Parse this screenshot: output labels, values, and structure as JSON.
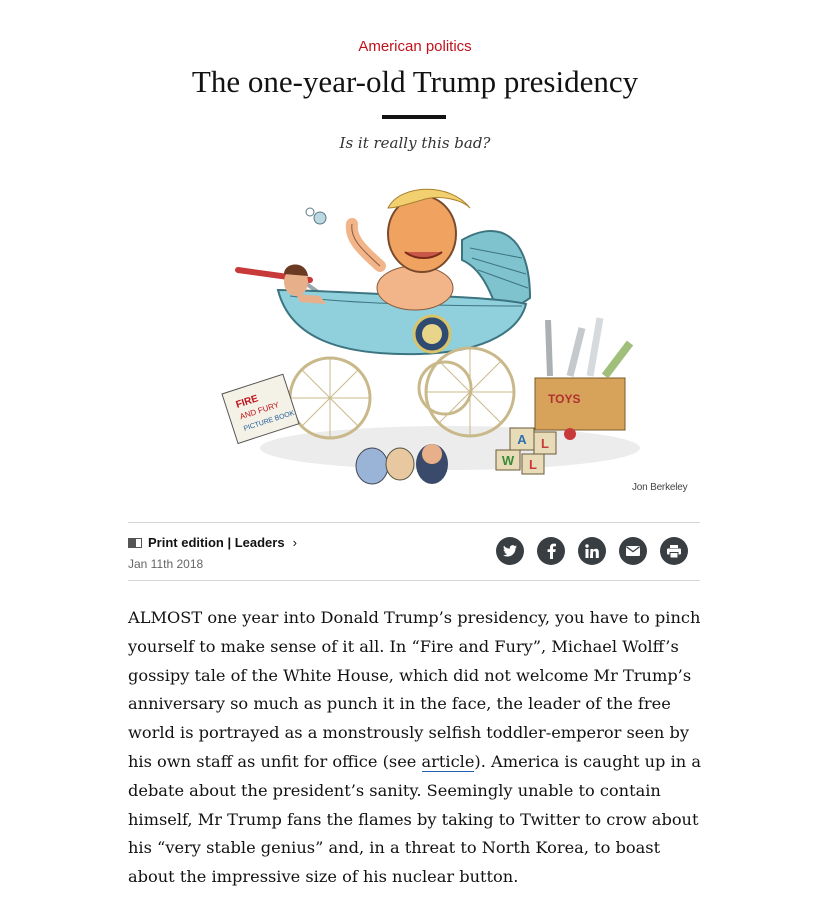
{
  "header": {
    "section": "American politics",
    "headline": "The one-year-old Trump presidency",
    "subhead": "Is it really this bad?"
  },
  "illustration": {
    "credit": "Jon Berkeley",
    "book_text": "FIRE AND FURY PICTURE BOOK",
    "toys_label": "TOYS",
    "blocks": [
      "A",
      "L",
      "W",
      "L"
    ]
  },
  "meta": {
    "print_label": "Print edition | Leaders",
    "chevron": "›",
    "date": "Jan 11th 2018",
    "share": [
      {
        "icon": "twitter-icon"
      },
      {
        "icon": "facebook-icon"
      },
      {
        "icon": "linkedin-icon"
      },
      {
        "icon": "email-icon"
      },
      {
        "icon": "print-icon"
      }
    ]
  },
  "article": {
    "p1_before": "ALMOST one year into Donald Trump’s presidency, you have to pinch yourself to make sense of it all. In “Fire and Fury”, Michael Wolff’s gossipy tale of the White House, which did not welcome Mr Trump’s anniversary so much as punch it in the face, the leader of the free world is portrayed as a monstrously selfish toddler-emperor seen by his own staff as unfit for office (see ",
    "p1_link": "article",
    "p1_after": "). America is caught up in a debate about the president’s sanity. Seemingly unable to contain himself, Mr Trump fans the flames by taking to Twitter to crow about his “very stable genius” and, in a threat to North Korea, to boast about the impressive size of his nuclear button."
  },
  "colors": {
    "section_red": "#c0121b",
    "icon_bg": "#383e42",
    "link_underline": "#1f5faa"
  }
}
